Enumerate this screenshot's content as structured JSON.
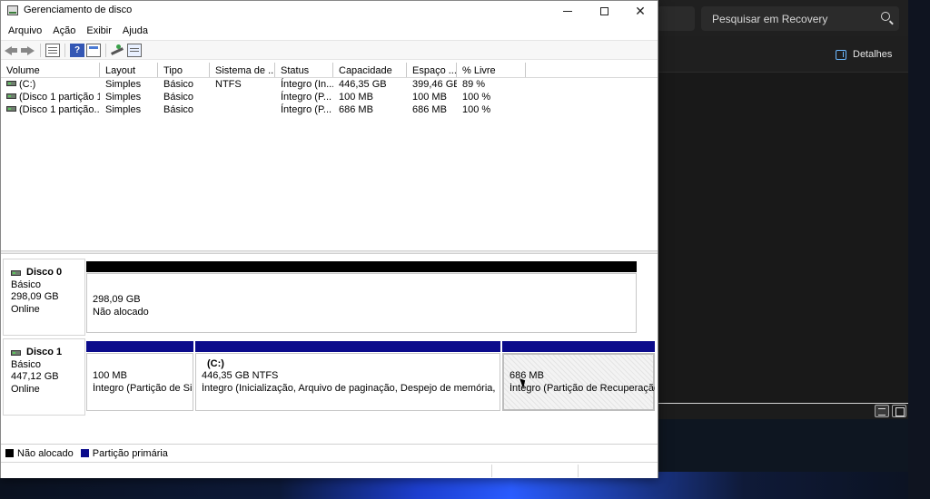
{
  "window": {
    "title": "Gerenciamento de disco",
    "close_glyph": "✕"
  },
  "menu": [
    "Arquivo",
    "Ação",
    "Exibir",
    "Ajuda"
  ],
  "toolbar": {
    "help_glyph": "?"
  },
  "table": {
    "columns": [
      "Volume",
      "Layout",
      "Tipo",
      "Sistema de ...",
      "Status",
      "Capacidade",
      "Espaço ...",
      "% Livre"
    ],
    "rows": [
      [
        "(C:)",
        "Simples",
        "Básico",
        "NTFS",
        "Íntegro (In...",
        "446,35 GB",
        "399,46 GB",
        "89 %"
      ],
      [
        "(Disco 1 partição 1)",
        "Simples",
        "Básico",
        "",
        "Íntegro (P...",
        "100 MB",
        "100 MB",
        "100 %"
      ],
      [
        "(Disco 1 partição...",
        "Simples",
        "Básico",
        "",
        "Íntegro (P...",
        "686 MB",
        "686 MB",
        "100 %"
      ]
    ]
  },
  "disks": [
    {
      "name": "Disco 0",
      "type": "Básico",
      "size": "298,09 GB",
      "state": "Online",
      "partitions": [
        {
          "title": "",
          "size": "298,09 GB",
          "status": "Não alocado"
        }
      ]
    },
    {
      "name": "Disco 1",
      "type": "Básico",
      "size": "447,12 GB",
      "state": "Online",
      "partitions": [
        {
          "title": "",
          "size": "100 MB",
          "status": "Íntegro (Partição de Sist"
        },
        {
          "title": "(C:)",
          "size": "446,35 GB NTFS",
          "status": "Íntegro (Inicialização, Arquivo de paginação, Despejo de memória, Partiç"
        },
        {
          "title": "",
          "size": "686 MB",
          "status": "Íntegro (Partição de Recuperação)"
        }
      ]
    }
  ],
  "legend": [
    {
      "label": "Não alocado",
      "color": "#000000"
    },
    {
      "label": "Partição primária",
      "color": "#0b0b8b"
    }
  ],
  "explorer": {
    "search_placeholder": "Pesquisar em Recovery",
    "details_label": "Detalhes"
  }
}
